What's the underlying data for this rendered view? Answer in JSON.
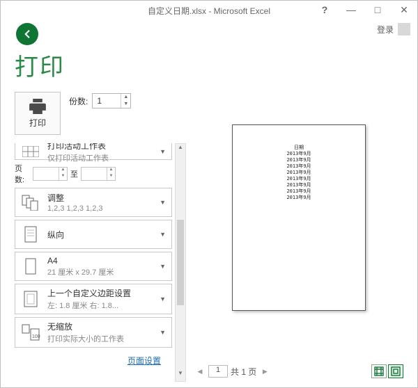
{
  "title": "自定义日期.xlsx - Microsoft Excel",
  "login": "登录",
  "page_heading": "打印",
  "print_button": "打印",
  "copies_label": "份数:",
  "copies_value": "1",
  "active_sheet": {
    "title": "打印活动工作表",
    "sub": "仅打印活动工作表"
  },
  "pages_from": "页数:",
  "pages_to": "至",
  "collate": {
    "title": "调整",
    "sub": "1,2,3    1,2,3    1,2,3"
  },
  "orientation": {
    "title": "纵向",
    "sub": ""
  },
  "papersize": {
    "title": "A4",
    "sub": "21 厘米 x 29.7 厘米"
  },
  "margins": {
    "title": "上一个自定义边距设置",
    "sub": "左: 1.8 厘米   右: 1.8..."
  },
  "scaling": {
    "title": "无缩放",
    "sub": "打印实际大小的工作表"
  },
  "page_setup": "页面设置",
  "pager": {
    "current": "1",
    "total_label": "共 1 页"
  },
  "preview_lines": "日期\n2013年9月\n2013年9月\n2013年9月\n2013年9月\n2013年9月\n2013年9月\n2013年9月\n2013年9月"
}
